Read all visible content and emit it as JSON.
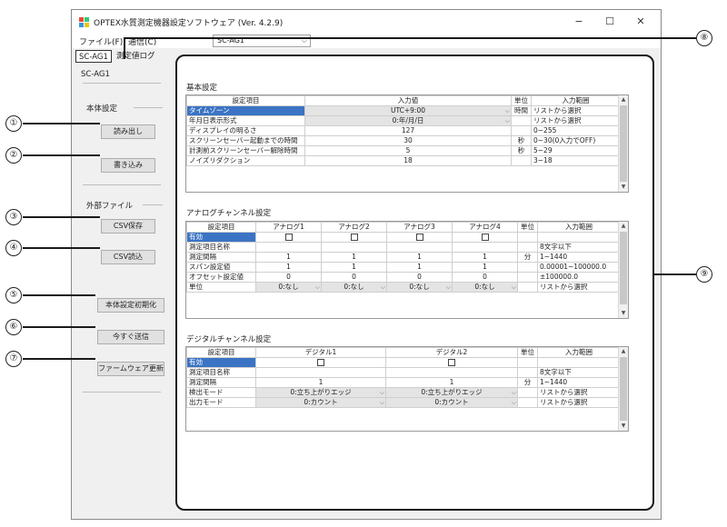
{
  "window": {
    "title": "OPTEX水質測定機器設定ソフトウェア (Ver. 4.2.9)",
    "minimize": "−",
    "maximize": "☐",
    "close": "✕"
  },
  "menu": {
    "file": "ファイル(F)",
    "comm": "通信(C)",
    "device_select": "SC-AG1"
  },
  "tabs": [
    {
      "label": "SC-AG1"
    },
    {
      "label": "測定値ログ"
    }
  ],
  "device_label": "SC-AG1",
  "left": {
    "group1": "本体設定",
    "read": "読み出し",
    "write": "書き込み",
    "group2": "外部ファイル",
    "csv_save": "CSV保存",
    "csv_load": "CSV読込",
    "init": "本体設定初期化",
    "send_now": "今すぐ送信",
    "firmware": "ファームウェア更新"
  },
  "basic": {
    "title": "基本設定",
    "headers": [
      "設定項目",
      "入力値",
      "単位",
      "入力範囲"
    ],
    "rows": [
      {
        "item": "タイムゾーン",
        "value": "UTC+9:00",
        "unit": "時間",
        "range": "リストから選択"
      },
      {
        "item": "年月日表示形式",
        "value": "0:年/月/日",
        "unit": "",
        "range": "リストから選択"
      },
      {
        "item": "ディスプレイの明るさ",
        "value": "127",
        "unit": "",
        "range": "0~255"
      },
      {
        "item": "スクリーンセーバー起動までの時間",
        "value": "30",
        "unit": "秒",
        "range": "0~30(0入力でOFF)"
      },
      {
        "item": "計測前スクリーンセーバー解除時間",
        "value": "5",
        "unit": "秒",
        "range": "5~29"
      },
      {
        "item": "ノイズリダクション",
        "value": "18",
        "unit": "",
        "range": "3~18"
      }
    ]
  },
  "analog": {
    "title": "アナログチャンネル設定",
    "headers": [
      "設定項目",
      "アナログ1",
      "アナログ2",
      "アナログ3",
      "アナログ4",
      "単位",
      "入力範囲"
    ],
    "rows": [
      {
        "item": "有効",
        "v": [
          "",
          "",
          "",
          ""
        ],
        "unit": "",
        "range": ""
      },
      {
        "item": "測定項目名称",
        "v": [
          "",
          "",
          "",
          ""
        ],
        "unit": "",
        "range": "8文字以下"
      },
      {
        "item": "測定間隔",
        "v": [
          "1",
          "1",
          "1",
          "1"
        ],
        "unit": "分",
        "range": "1~1440"
      },
      {
        "item": "スパン設定値",
        "v": [
          "1",
          "1",
          "1",
          "1"
        ],
        "unit": "",
        "range": "0.00001~100000.0"
      },
      {
        "item": "オフセット設定値",
        "v": [
          "0",
          "0",
          "0",
          "0"
        ],
        "unit": "",
        "range": "±100000.0"
      },
      {
        "item": "単位",
        "v": [
          "0:なし",
          "0:なし",
          "0:なし",
          "0:なし"
        ],
        "unit": "",
        "range": "リストから選択"
      }
    ]
  },
  "digital": {
    "title": "デジタルチャンネル設定",
    "headers": [
      "設定項目",
      "デジタル1",
      "デジタル2",
      "単位",
      "入力範囲"
    ],
    "rows": [
      {
        "item": "有効",
        "v": [
          "",
          ""
        ],
        "unit": "",
        "range": ""
      },
      {
        "item": "測定項目名称",
        "v": [
          "",
          ""
        ],
        "unit": "",
        "range": "8文字以下"
      },
      {
        "item": "測定間隔",
        "v": [
          "1",
          "1"
        ],
        "unit": "分",
        "range": "1~1440"
      },
      {
        "item": "検出モード",
        "v": [
          "0:立ち上がりエッジ",
          "0:立ち上がりエッジ"
        ],
        "unit": "",
        "range": "リストから選択"
      },
      {
        "item": "出力モード",
        "v": [
          "0:カウント",
          "0:カウント"
        ],
        "unit": "",
        "range": "リストから選択"
      }
    ]
  },
  "callouts": [
    "①",
    "②",
    "③",
    "④",
    "⑤",
    "⑥",
    "⑦",
    "⑧",
    "⑨"
  ],
  "colors": {
    "selection": "#3b74c4",
    "disabled_cell": "#e4e4e4",
    "accent_frame": "#1a1a1a"
  }
}
